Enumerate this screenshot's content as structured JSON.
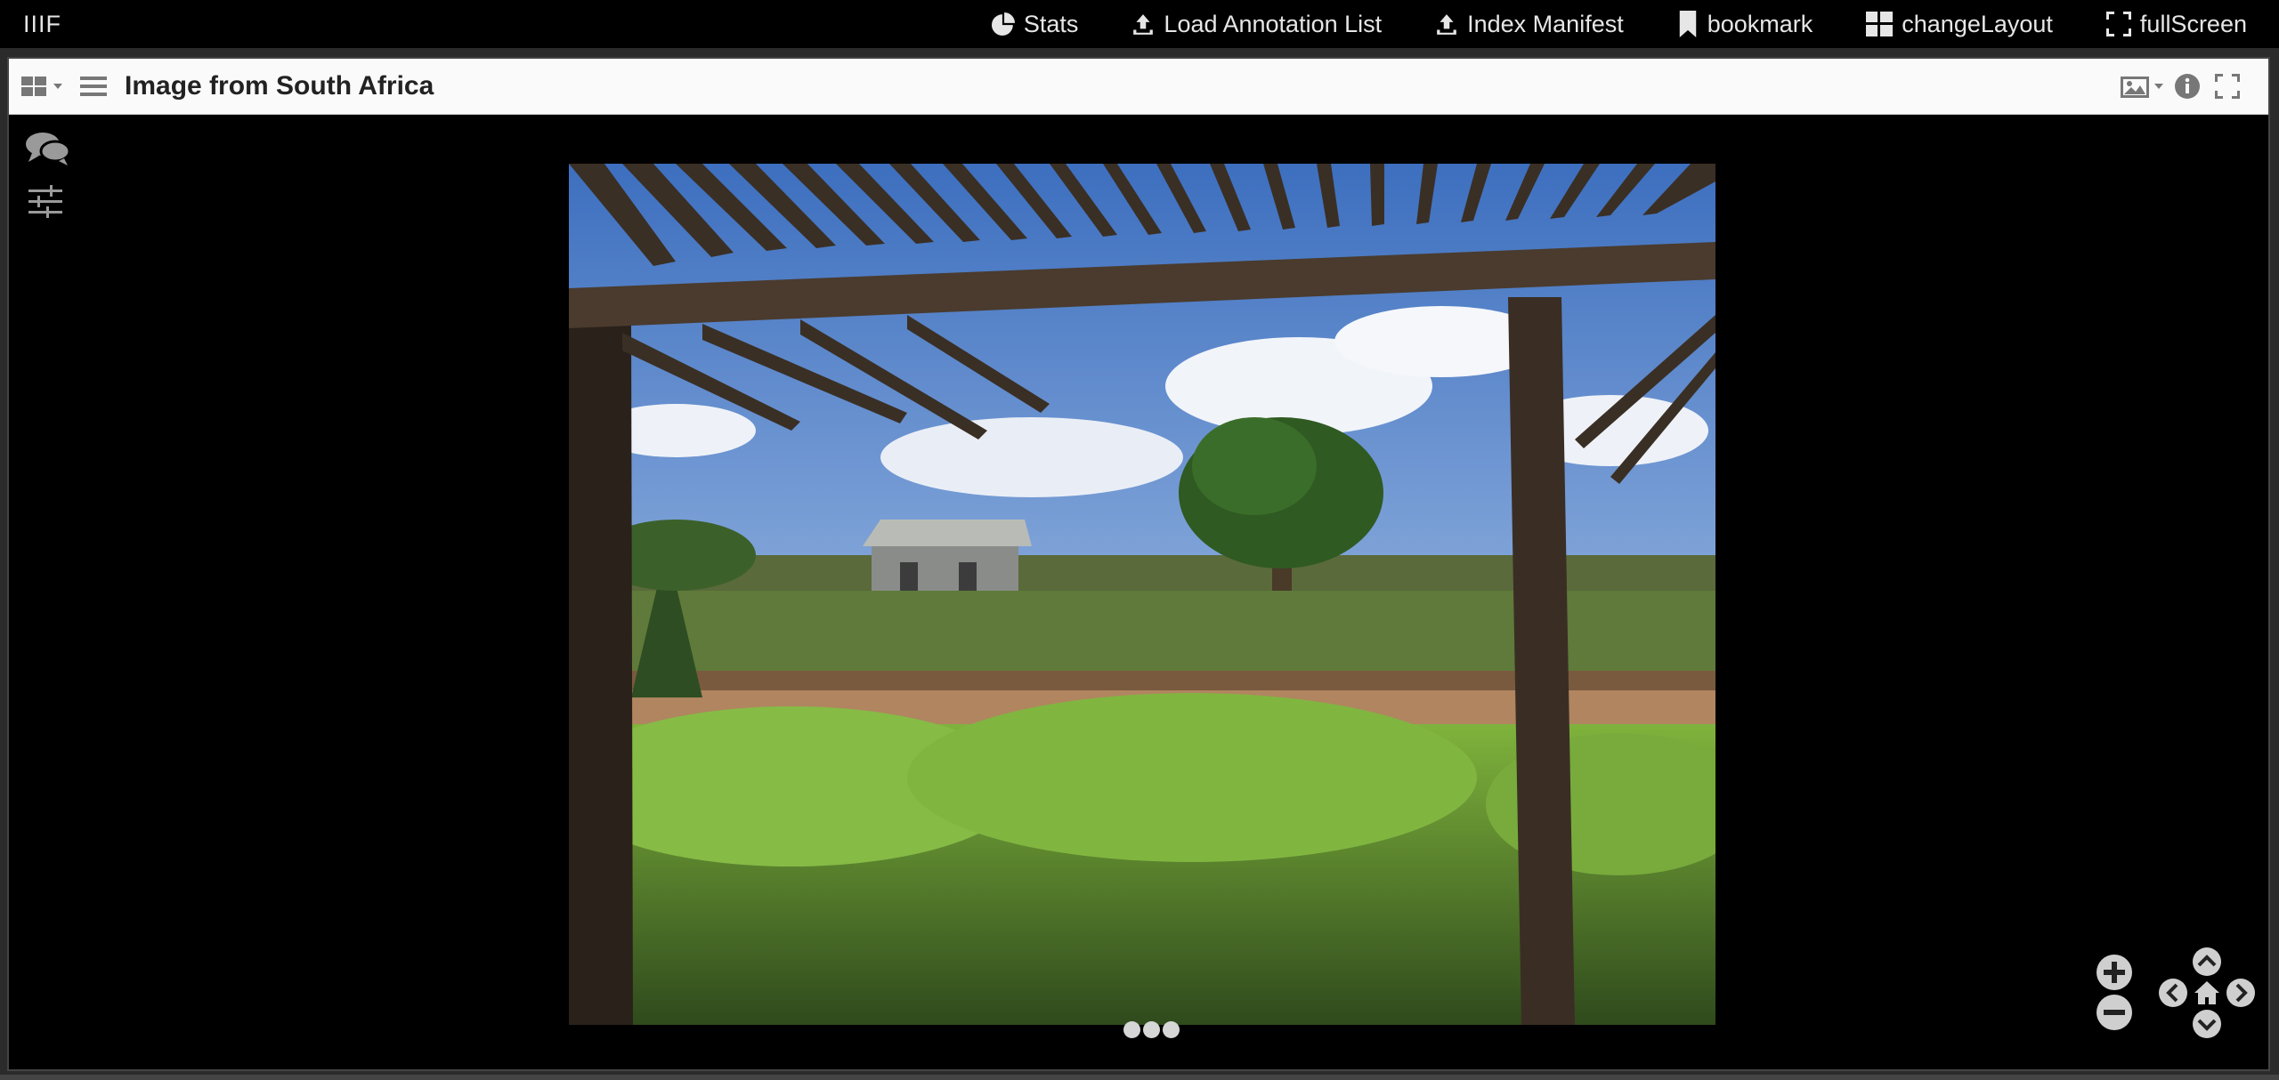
{
  "topbar": {
    "brand": "IIIF",
    "menu": [
      {
        "label": "Stats",
        "icon": "pie-chart-icon"
      },
      {
        "label": "Load Annotation List",
        "icon": "upload-icon"
      },
      {
        "label": "Index Manifest",
        "icon": "upload-icon"
      },
      {
        "label": "bookmark",
        "icon": "bookmark-icon"
      },
      {
        "label": "changeLayout",
        "icon": "grid-layout-icon"
      },
      {
        "label": "fullScreen",
        "icon": "expand-icon"
      }
    ]
  },
  "window": {
    "title": "Image from South Africa",
    "left_controls": [
      "view-grid-icon",
      "hamburger-menu-icon"
    ],
    "right_controls": [
      "image-view-icon",
      "info-icon",
      "fullscreen-icon"
    ],
    "side_tools": [
      "annotations-comment-icon",
      "image-adjust-sliders-icon"
    ]
  },
  "image": {
    "alt": "Image from South Africa"
  },
  "pager": {
    "dots": 3
  },
  "colors": {
    "topbar_bg": "#000000",
    "header_bg": "#fafafa",
    "viewer_bg": "#000000",
    "icon_gray": "#9a9a9a"
  }
}
